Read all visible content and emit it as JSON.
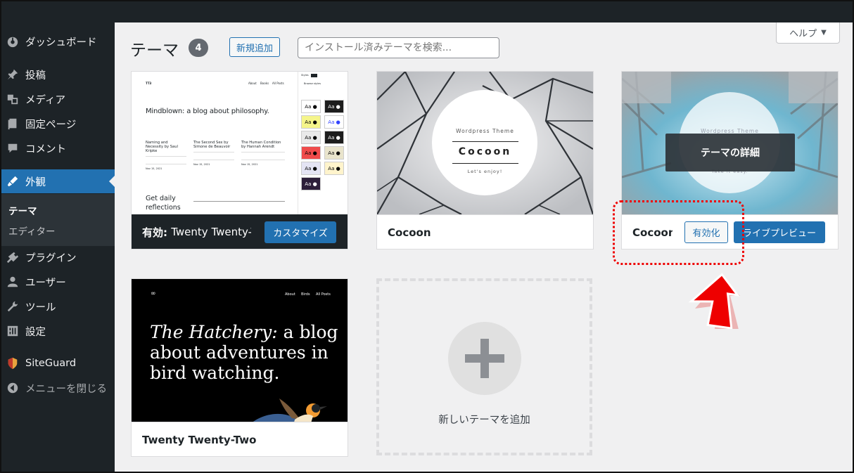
{
  "sidebar": {
    "items": [
      {
        "label": "ダッシュボード",
        "icon": "dashboard-icon"
      },
      {
        "label": "投稿",
        "icon": "pin-icon"
      },
      {
        "label": "メディア",
        "icon": "media-icon"
      },
      {
        "label": "固定ページ",
        "icon": "page-icon"
      },
      {
        "label": "コメント",
        "icon": "comment-icon"
      },
      {
        "label": "外観",
        "icon": "brush-icon"
      },
      {
        "label": "プラグイン",
        "icon": "plugin-icon"
      },
      {
        "label": "ユーザー",
        "icon": "user-icon"
      },
      {
        "label": "ツール",
        "icon": "wrench-icon"
      },
      {
        "label": "設定",
        "icon": "settings-icon"
      },
      {
        "label": "SiteGuard",
        "icon": "siteguard-icon"
      },
      {
        "label": "メニューを閉じる",
        "icon": "collapse-icon"
      }
    ],
    "submenu": [
      "テーマ",
      "エディター"
    ]
  },
  "header": {
    "help": "ヘルプ",
    "title": "テーマ",
    "count": "4",
    "add_new": "新規追加",
    "search_placeholder": "インストール済みテーマを検索..."
  },
  "themes": {
    "active": {
      "label": "有効:",
      "name": "Twenty Twenty-Three",
      "customize": "カスタマイズ",
      "preview": {
        "logo": "TT3",
        "nav": [
          "About",
          "Books",
          "All Posts"
        ],
        "headline": "Mindblown: a blog about philosophy.",
        "posts": [
          {
            "title": "Naming and Necessity by Saul Kripke",
            "date": "Nov 15, 2021"
          },
          {
            "title": "The Second Sex by Simone de Beauvoir",
            "date": "Nov 15, 2021"
          },
          {
            "title": "The Human Condition by Hannah Arendt",
            "date": "Nov 15, 2021"
          }
        ],
        "footer_text": "Get daily reflections",
        "panel_title": "Styles",
        "panel_sub": "Browse styles",
        "swatch_text": "Aa"
      }
    },
    "cocoon": {
      "name": "Cocoon",
      "preview": {
        "top": "Wordpress Theme",
        "title": "Cocoon",
        "bottom": "Let's enjoy!"
      }
    },
    "cocoon_child": {
      "name": "Cocoon Ch",
      "overlay": "テーマの詳細",
      "activate": "有効化",
      "live_preview": "ライブプレビュー",
      "preview": {
        "top": "Wordpress Theme",
        "bottom": "Take it easy."
      }
    },
    "twentytwo": {
      "name": "Twenty Twenty-Two",
      "preview": {
        "nav": [
          "About",
          "Birds",
          "All Posts"
        ],
        "line1_italic": "The Hatchery:",
        "line1_rest": " a blog",
        "line2": "about adventures in",
        "line3": "bird watching."
      }
    },
    "add_new_label": "新しいテーマを追加"
  },
  "colors": {
    "accent": "#2271b1",
    "sidebar": "#1d2327",
    "highlight": "#ee0000"
  }
}
